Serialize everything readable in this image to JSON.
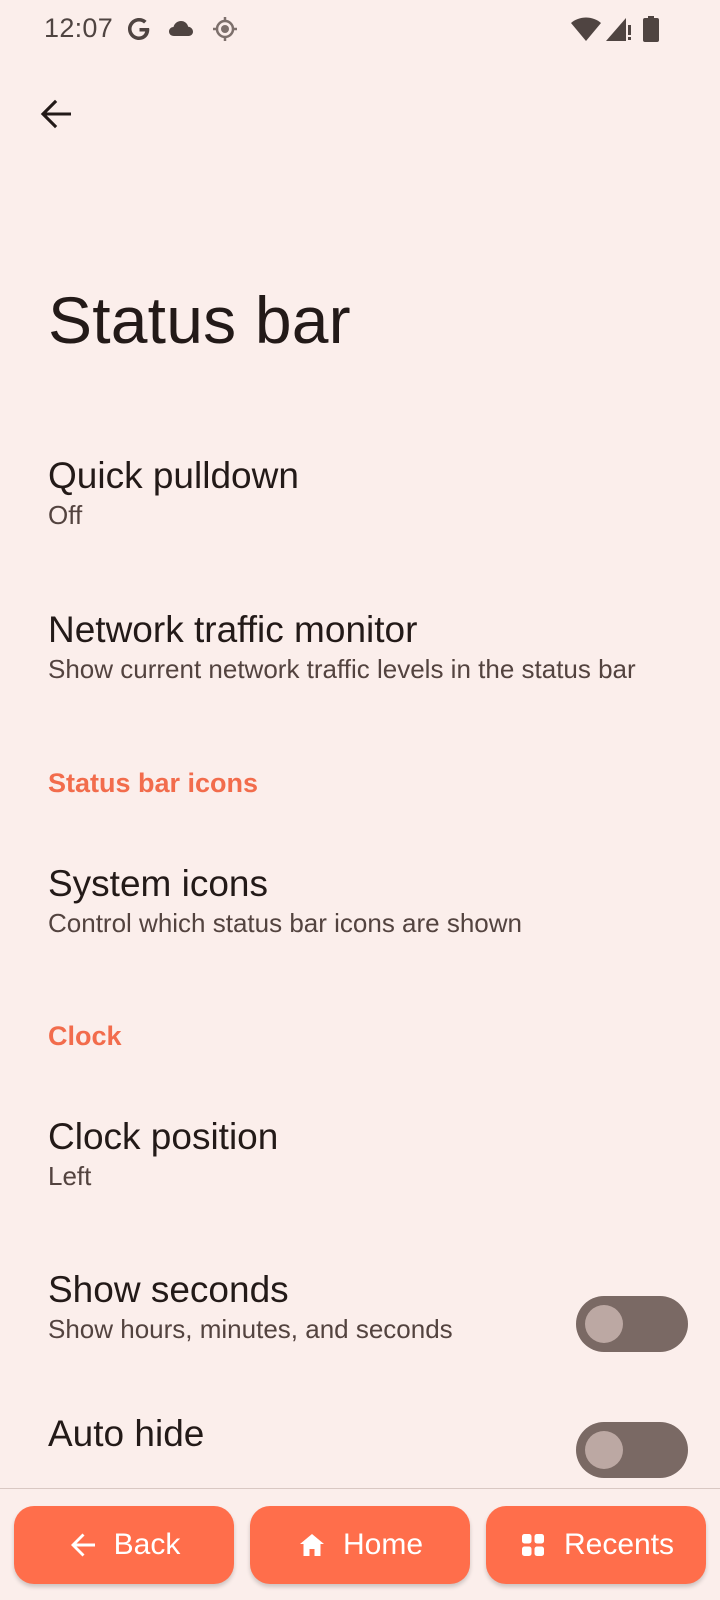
{
  "status_bar": {
    "time": "12:07",
    "left_icons": [
      "google-icon",
      "cloud-icon",
      "location-icon"
    ],
    "right_icons": [
      "wifi-icon",
      "signal-icon",
      "battery-icon"
    ]
  },
  "header": {
    "title": "Status bar"
  },
  "items": {
    "quick_pulldown": {
      "title": "Quick pulldown",
      "summary": "Off"
    },
    "network_traffic": {
      "title": "Network traffic monitor",
      "summary": "Show current network traffic levels in the status bar"
    },
    "status_bar_icons_category": "Status bar icons",
    "system_icons": {
      "title": "System icons",
      "summary": "Control which status bar icons are shown"
    },
    "clock_category": "Clock",
    "clock_position": {
      "title": "Clock position",
      "summary": "Left"
    },
    "show_seconds": {
      "title": "Show seconds",
      "summary": "Show hours, minutes, and seconds",
      "enabled": false
    },
    "auto_hide": {
      "title": "Auto hide",
      "enabled": false
    }
  },
  "nav": {
    "back_label": "Back",
    "home_label": "Home",
    "recents_label": "Recents"
  },
  "colors": {
    "background": "#fbeeeb",
    "accent": "#f26c4c",
    "nav_button": "#ff6e4b",
    "switch_track_off": "#7a6964"
  }
}
